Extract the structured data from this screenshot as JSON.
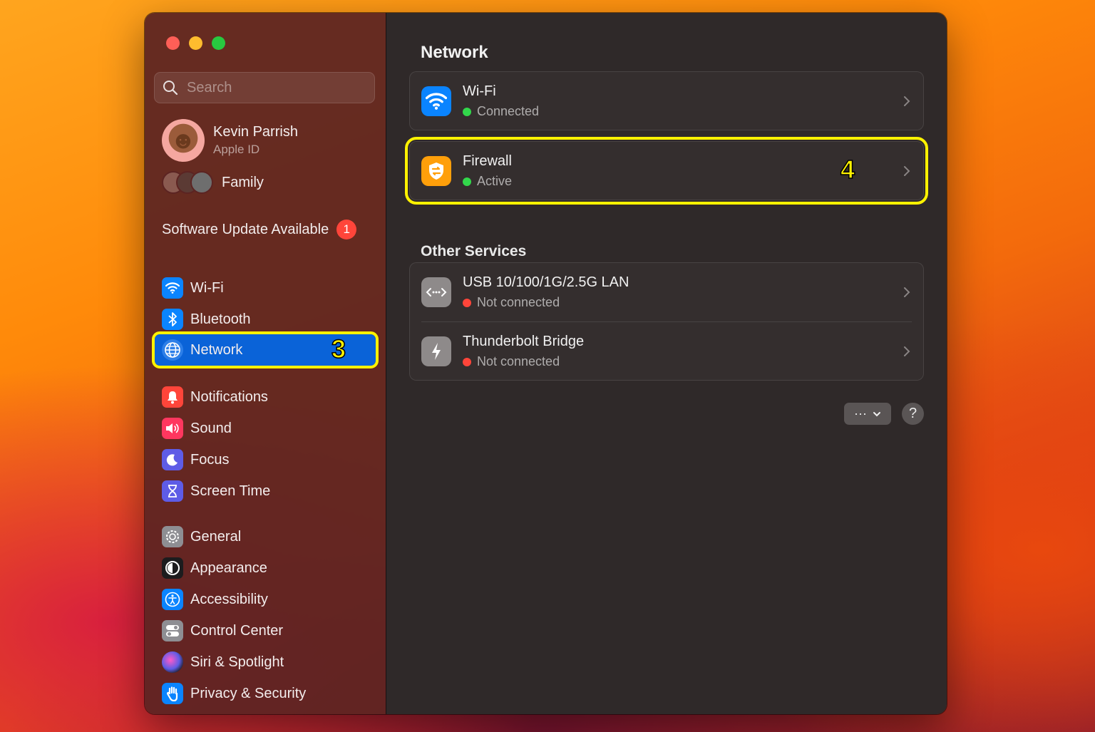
{
  "sidebar": {
    "search_placeholder": "Search",
    "profile": {
      "name": "Kevin Parrish",
      "subtitle": "Apple ID"
    },
    "family_label": "Family",
    "update": {
      "label": "Software Update Available",
      "count": "1"
    },
    "items": [
      {
        "label": "Wi-Fi",
        "icon": "wifi-icon",
        "color": "#0a84ff"
      },
      {
        "label": "Bluetooth",
        "icon": "bluetooth-icon",
        "color": "#0a84ff"
      },
      {
        "label": "Network",
        "icon": "globe-icon",
        "color": "#0a84ff",
        "selected": true
      },
      {
        "label": "Notifications",
        "icon": "bell-icon",
        "color": "#ff453a"
      },
      {
        "label": "Sound",
        "icon": "speaker-icon",
        "color": "#ff375f"
      },
      {
        "label": "Focus",
        "icon": "moon-icon",
        "color": "#5e5ce6"
      },
      {
        "label": "Screen Time",
        "icon": "hourglass-icon",
        "color": "#5e5ce6"
      },
      {
        "label": "General",
        "icon": "gear-icon",
        "color": "#8e8e93"
      },
      {
        "label": "Appearance",
        "icon": "appearance-icon",
        "color": "#1c1c1e"
      },
      {
        "label": "Accessibility",
        "icon": "accessibility-icon",
        "color": "#0a84ff"
      },
      {
        "label": "Control Center",
        "icon": "control-center-icon",
        "color": "#8e8e93"
      },
      {
        "label": "Siri & Spotlight",
        "icon": "siri-icon",
        "color": "#bf5af2"
      },
      {
        "label": "Privacy & Security",
        "icon": "hand-icon",
        "color": "#0a84ff"
      }
    ]
  },
  "annotations": {
    "step3": "3",
    "step4": "4",
    "highlight_color": "#fff200"
  },
  "main": {
    "title": "Network",
    "services": [
      {
        "title": "Wi-Fi",
        "status": "Connected",
        "status_color": "green",
        "icon": "wifi-icon"
      },
      {
        "title": "Firewall",
        "status": "Active",
        "status_color": "green",
        "icon": "firewall-icon"
      }
    ],
    "other_title": "Other Services",
    "other_services": [
      {
        "title": "USB 10/100/1G/2.5G LAN",
        "status": "Not connected",
        "status_color": "red",
        "icon": "ethernet-icon"
      },
      {
        "title": "Thunderbolt Bridge",
        "status": "Not connected",
        "status_color": "red",
        "icon": "thunderbolt-icon"
      }
    ],
    "more_button": "···",
    "help_button": "?"
  }
}
